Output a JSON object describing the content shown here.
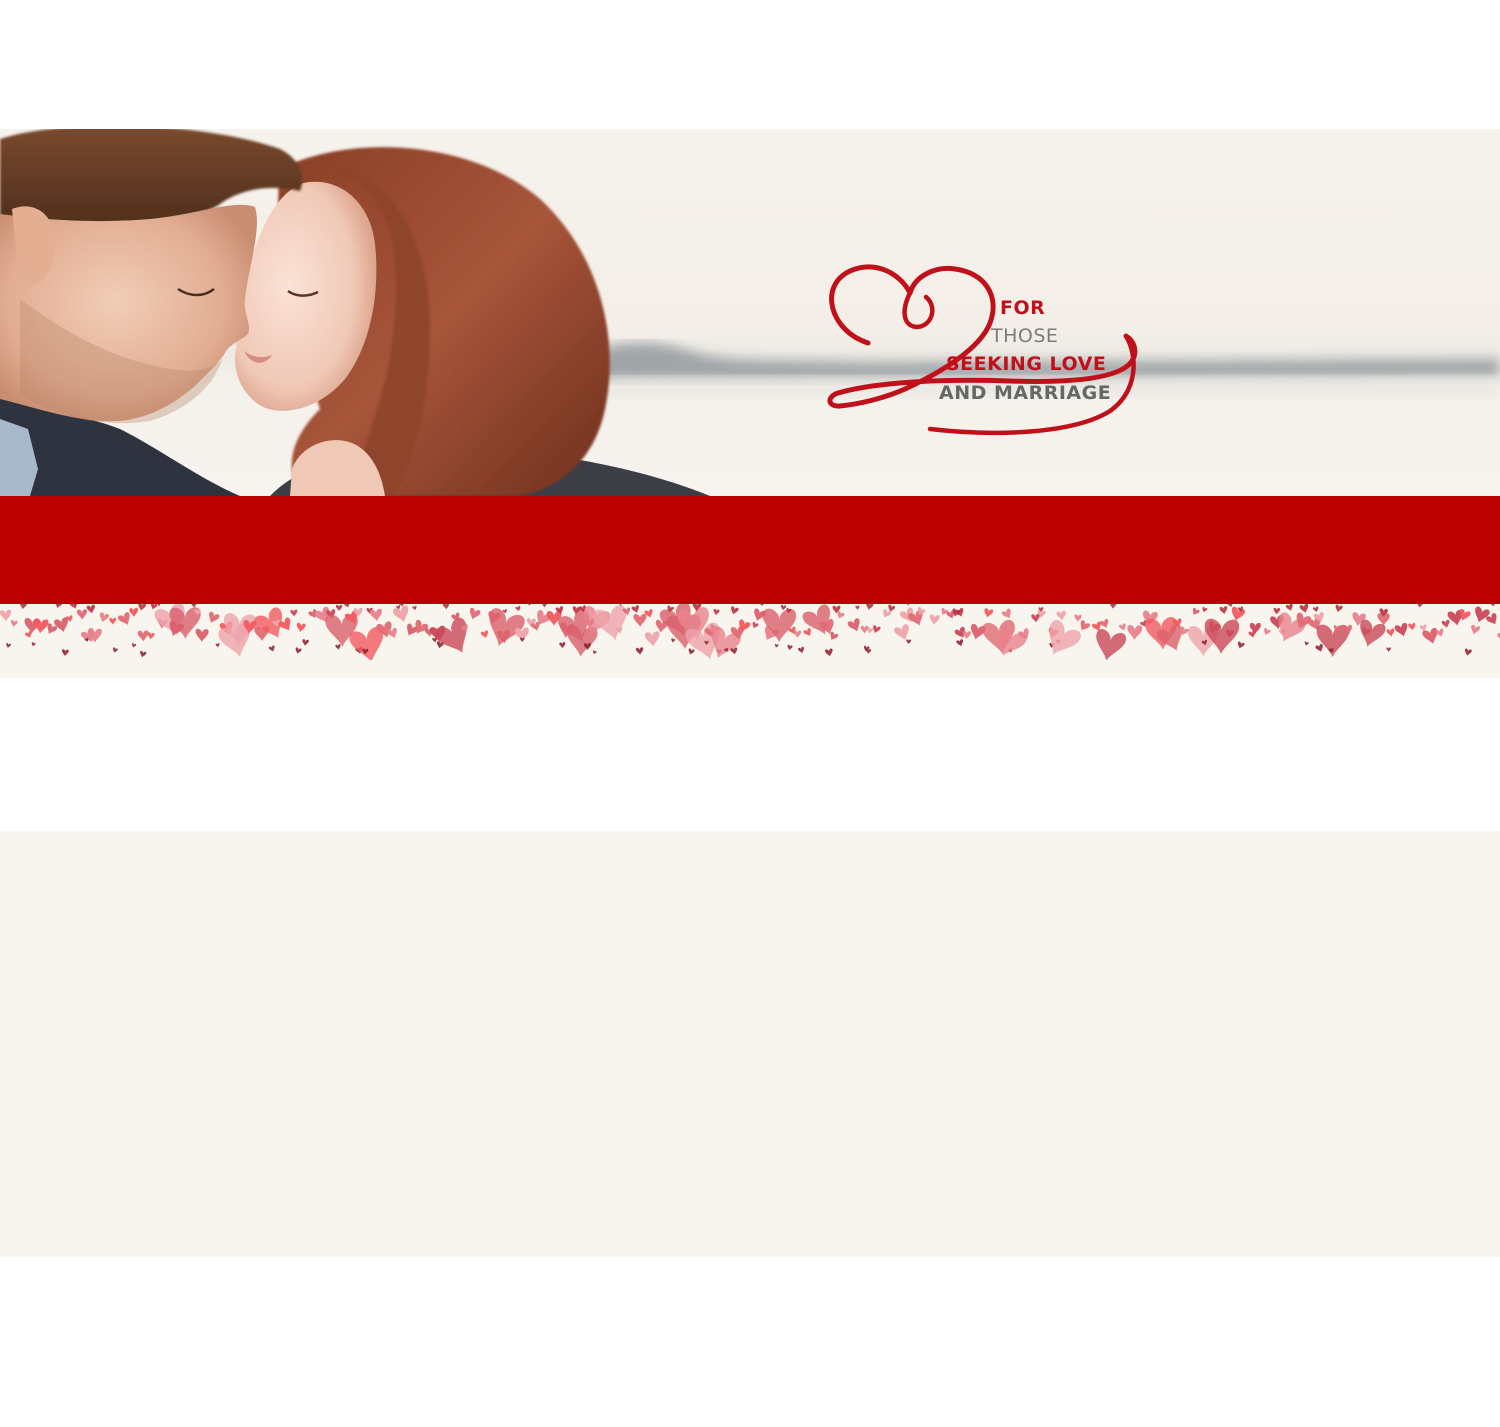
{
  "hero": {
    "photo_icon": "couple-photo",
    "logo": {
      "mark_icon": "heart-2-logo-icon",
      "lines": [
        "FOR",
        "THOSE",
        "SEEKING LOVE",
        "AND MARRIAGE"
      ]
    }
  },
  "colors": {
    "band_red": "#bc0000",
    "logo_red": "#c0111b",
    "logo_gray": "#6f6f6f",
    "cream": "#f8f5ee",
    "heart_pink": "#e8828c"
  }
}
